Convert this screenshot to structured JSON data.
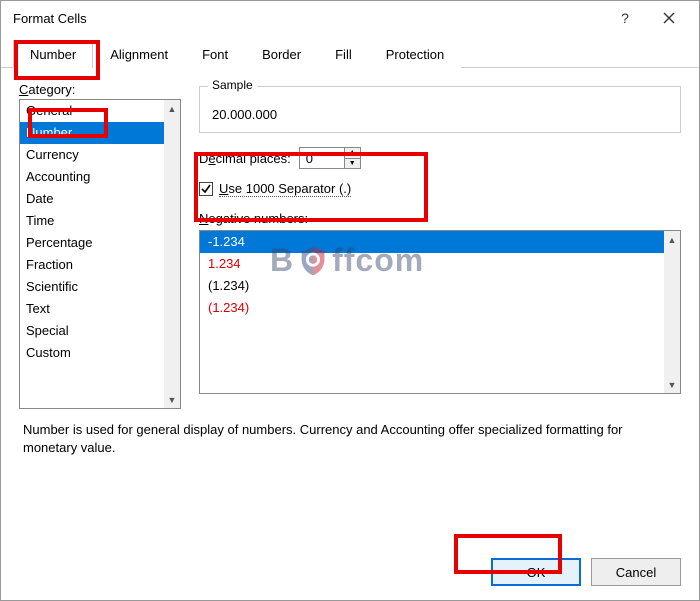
{
  "window": {
    "title": "Format Cells"
  },
  "tabs": {
    "items": [
      "Number",
      "Alignment",
      "Font",
      "Border",
      "Fill",
      "Protection"
    ],
    "active_index": 0
  },
  "category": {
    "label": "Category:",
    "items": [
      "General",
      "Number",
      "Currency",
      "Accounting",
      "Date",
      "Time",
      "Percentage",
      "Fraction",
      "Scientific",
      "Text",
      "Special",
      "Custom"
    ],
    "selected_index": 1
  },
  "sample": {
    "legend": "Sample",
    "value": "20.000.000"
  },
  "decimal": {
    "label_prefix": "D",
    "label_underline": "e",
    "label_suffix": "cimal places:",
    "value": "0"
  },
  "separator": {
    "checked": true,
    "label_prefix": "",
    "label_underline": "U",
    "label_suffix": "se 1000 Separator (.)"
  },
  "negative": {
    "label_prefix": "",
    "label_underline": "N",
    "label_suffix": "egative numbers:",
    "items": [
      {
        "text": "-1.234",
        "red": false,
        "selected": true
      },
      {
        "text": "1.234",
        "red": true,
        "selected": false
      },
      {
        "text": "(1.234)",
        "red": false,
        "selected": false
      },
      {
        "text": "(1.234)",
        "red": true,
        "selected": false
      }
    ]
  },
  "description": "Number is used for general display of numbers.  Currency and Accounting offer specialized formatting for monetary value.",
  "buttons": {
    "ok": "OK",
    "cancel": "Cancel"
  },
  "watermark": {
    "left": "B",
    "right": "ffcom"
  }
}
